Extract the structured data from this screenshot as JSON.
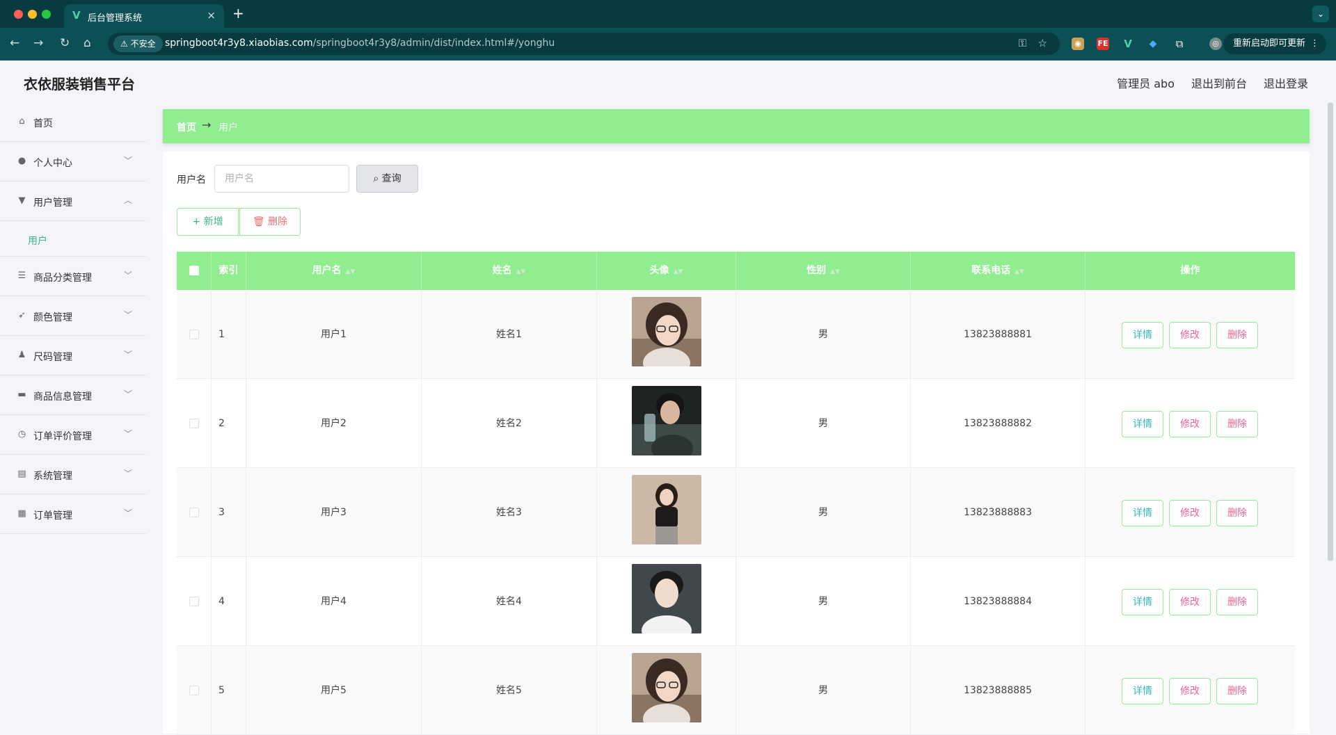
{
  "browser": {
    "tab_title": "后台管理系统",
    "tab_favicon": "V",
    "insecure_label": "不安全",
    "url_host": "springboot4r3y8.xiaobias.com",
    "url_path": "/springboot4r3y8/admin/dist/index.html#/yonghu",
    "update_label": "重新启动即可更新"
  },
  "header": {
    "brand": "衣依服装销售平台",
    "user_label": "管理员 abo",
    "to_front_label": "退出到前台",
    "logout_label": "退出登录"
  },
  "sidebar": {
    "items": [
      {
        "label": "首页",
        "icon": "home-icon",
        "arrow": ""
      },
      {
        "label": "个人中心",
        "icon": "user-icon",
        "arrow": "﹀"
      },
      {
        "label": "用户管理",
        "icon": "pin-icon",
        "arrow": "︿"
      },
      {
        "label": "商品分类管理",
        "icon": "list-icon",
        "arrow": "﹀"
      },
      {
        "label": "颜色管理",
        "icon": "send-icon",
        "arrow": "﹀"
      },
      {
        "label": "尺码管理",
        "icon": "person-icon",
        "arrow": "﹀"
      },
      {
        "label": "商品信息管理",
        "icon": "chat-icon",
        "arrow": "﹀"
      },
      {
        "label": "订单评价管理",
        "icon": "gauge-icon",
        "arrow": "﹀"
      },
      {
        "label": "系统管理",
        "icon": "clipboard-icon",
        "arrow": "﹀"
      },
      {
        "label": "订单管理",
        "icon": "grid-icon",
        "arrow": "﹀"
      }
    ],
    "submenu_label": "用户"
  },
  "breadcrumb": {
    "home": "首页",
    "arrow": "→",
    "current": "用户"
  },
  "search": {
    "label": "用户名",
    "placeholder": "用户名",
    "value": "",
    "button_label": "查询"
  },
  "actions": {
    "add_label": "新增",
    "delete_label": "删除"
  },
  "table": {
    "columns": [
      "索引",
      "用户名",
      "姓名",
      "头像",
      "性别",
      "联系电话",
      "操作"
    ],
    "rows": [
      {
        "index": "1",
        "username": "用户1",
        "name": "姓名1",
        "gender": "男",
        "phone": "13823888881"
      },
      {
        "index": "2",
        "username": "用户2",
        "name": "姓名2",
        "gender": "男",
        "phone": "13823888882"
      },
      {
        "index": "3",
        "username": "用户3",
        "name": "姓名3",
        "gender": "男",
        "phone": "13823888883"
      },
      {
        "index": "4",
        "username": "用户4",
        "name": "姓名4",
        "gender": "男",
        "phone": "13823888884"
      },
      {
        "index": "5",
        "username": "用户5",
        "name": "姓名5",
        "gender": "男",
        "phone": "13823888885"
      }
    ],
    "op_labels": {
      "detail": "详情",
      "edit": "修改",
      "delete": "删除"
    }
  },
  "colors": {
    "accent": "#90ee90",
    "teal": "#3ab58a",
    "danger": "#f56c6c"
  }
}
